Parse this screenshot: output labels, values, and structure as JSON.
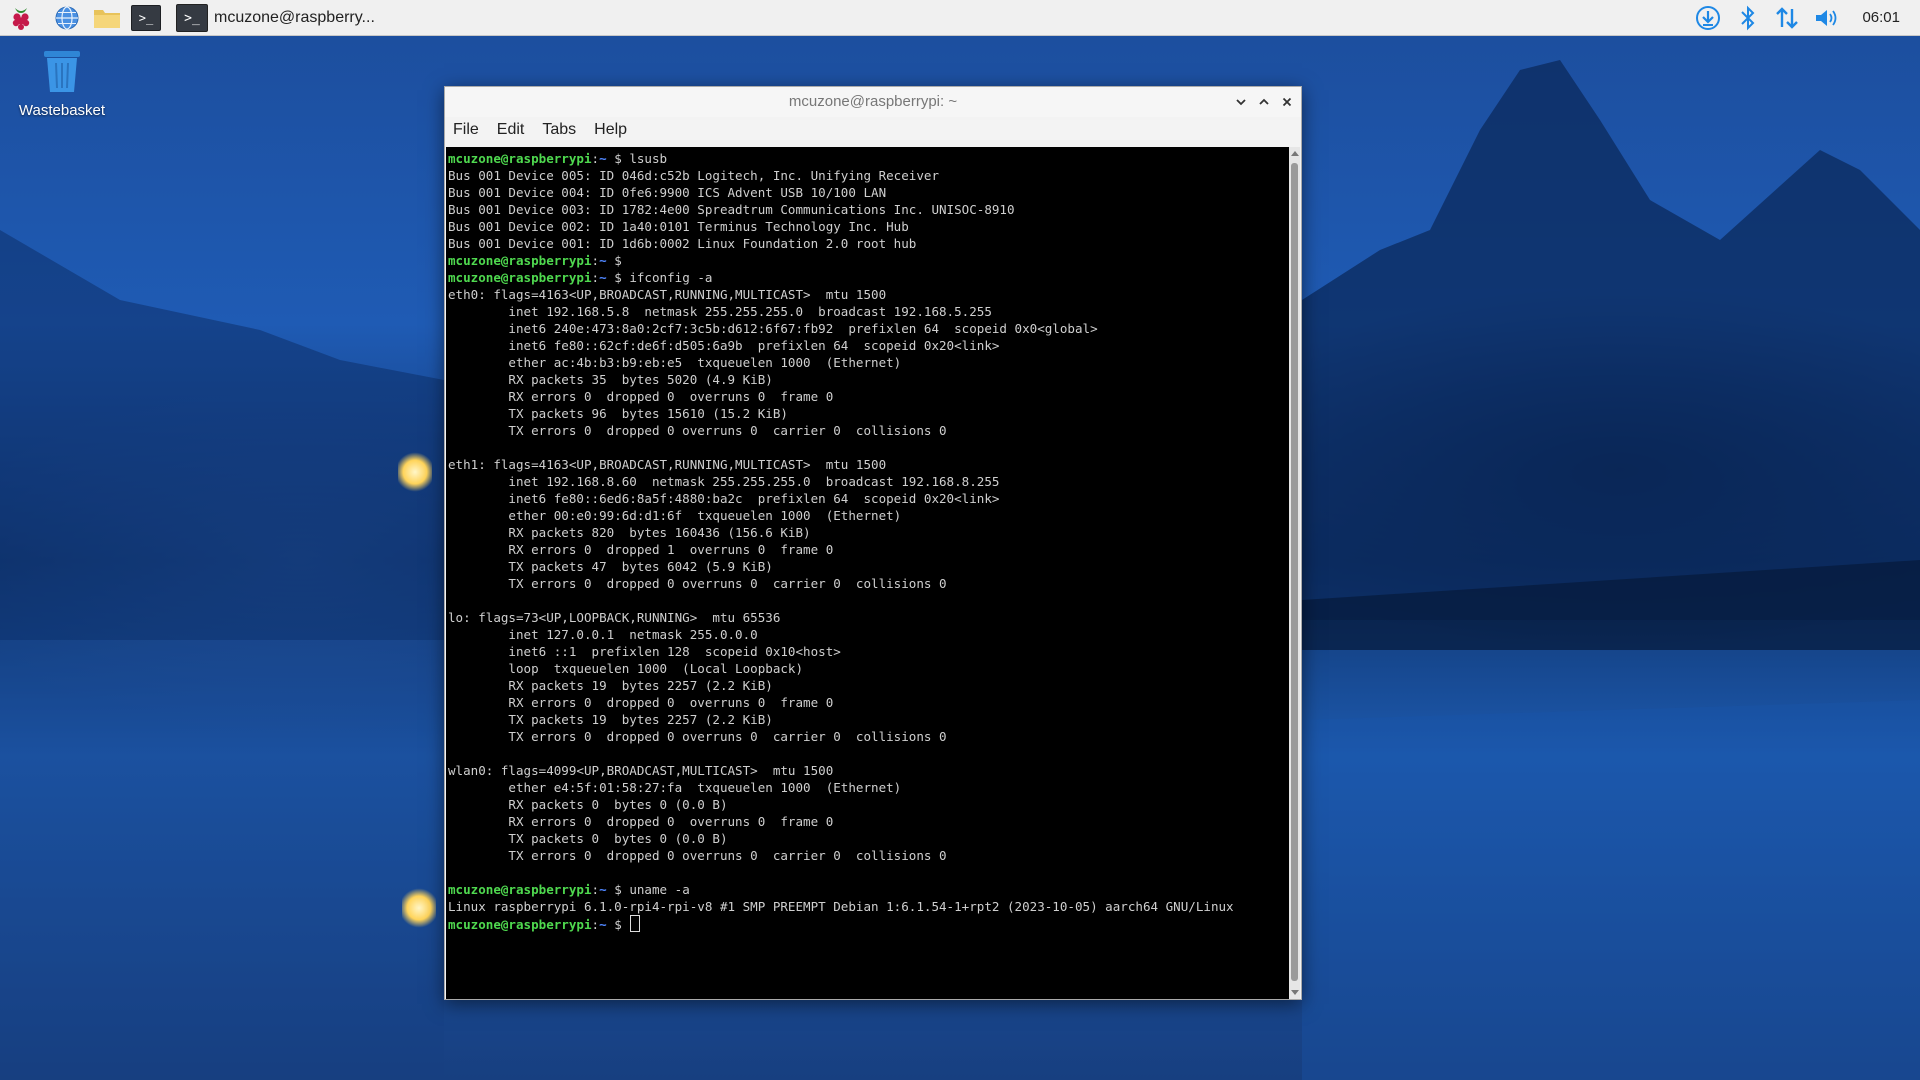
{
  "taskbar": {
    "icons": [
      "raspberry-menu-icon",
      "web-browser-icon",
      "file-manager-icon",
      "terminal-icon"
    ],
    "task_label": "mcuzone@raspberry...",
    "tray_icons": [
      "updater-icon",
      "bluetooth-icon",
      "network-icon",
      "volume-icon"
    ],
    "clock": "06:01",
    "tray_accent_color": "#1e88e5"
  },
  "desktop": {
    "icons": [
      {
        "label": "Wastebasket",
        "icon": "wastebasket-icon"
      }
    ]
  },
  "window": {
    "title": "mcuzone@raspberrypi: ~",
    "controls": [
      "minimize",
      "maximize",
      "close"
    ],
    "menu": [
      "File",
      "Edit",
      "Tabs",
      "Help"
    ]
  },
  "terminal": {
    "colors": {
      "background": "#000000",
      "text": "#cfcfcf",
      "user": "#4fd94f",
      "path": "#4f86ff"
    },
    "prompt_user": "mcuzone@raspberrypi",
    "prompt_path": "~",
    "lines": [
      {
        "type": "prompt",
        "cmd": "lsusb"
      },
      {
        "type": "out",
        "text": "Bus 001 Device 005: ID 046d:c52b Logitech, Inc. Unifying Receiver"
      },
      {
        "type": "out",
        "text": "Bus 001 Device 004: ID 0fe6:9900 ICS Advent USB 10/100 LAN"
      },
      {
        "type": "out",
        "text": "Bus 001 Device 003: ID 1782:4e00 Spreadtrum Communications Inc. UNISOC-8910"
      },
      {
        "type": "out",
        "text": "Bus 001 Device 002: ID 1a40:0101 Terminus Technology Inc. Hub"
      },
      {
        "type": "out",
        "text": "Bus 001 Device 001: ID 1d6b:0002 Linux Foundation 2.0 root hub"
      },
      {
        "type": "prompt",
        "cmd": ""
      },
      {
        "type": "prompt",
        "cmd": "ifconfig -a"
      },
      {
        "type": "out",
        "text": "eth0: flags=4163<UP,BROADCAST,RUNNING,MULTICAST>  mtu 1500"
      },
      {
        "type": "out",
        "text": "        inet 192.168.5.8  netmask 255.255.255.0  broadcast 192.168.5.255"
      },
      {
        "type": "out",
        "text": "        inet6 240e:473:8a0:2cf7:3c5b:d612:6f67:fb92  prefixlen 64  scopeid 0x0<global>"
      },
      {
        "type": "out",
        "text": "        inet6 fe80::62cf:de6f:d505:6a9b  prefixlen 64  scopeid 0x20<link>"
      },
      {
        "type": "out",
        "text": "        ether ac:4b:b3:b9:eb:e5  txqueuelen 1000  (Ethernet)"
      },
      {
        "type": "out",
        "text": "        RX packets 35  bytes 5020 (4.9 KiB)"
      },
      {
        "type": "out",
        "text": "        RX errors 0  dropped 0  overruns 0  frame 0"
      },
      {
        "type": "out",
        "text": "        TX packets 96  bytes 15610 (15.2 KiB)"
      },
      {
        "type": "out",
        "text": "        TX errors 0  dropped 0 overruns 0  carrier 0  collisions 0"
      },
      {
        "type": "out",
        "text": ""
      },
      {
        "type": "out",
        "text": "eth1: flags=4163<UP,BROADCAST,RUNNING,MULTICAST>  mtu 1500"
      },
      {
        "type": "out",
        "text": "        inet 192.168.8.60  netmask 255.255.255.0  broadcast 192.168.8.255"
      },
      {
        "type": "out",
        "text": "        inet6 fe80::6ed6:8a5f:4880:ba2c  prefixlen 64  scopeid 0x20<link>"
      },
      {
        "type": "out",
        "text": "        ether 00:e0:99:6d:d1:6f  txqueuelen 1000  (Ethernet)"
      },
      {
        "type": "out",
        "text": "        RX packets 820  bytes 160436 (156.6 KiB)"
      },
      {
        "type": "out",
        "text": "        RX errors 0  dropped 1  overruns 0  frame 0"
      },
      {
        "type": "out",
        "text": "        TX packets 47  bytes 6042 (5.9 KiB)"
      },
      {
        "type": "out",
        "text": "        TX errors 0  dropped 0 overruns 0  carrier 0  collisions 0"
      },
      {
        "type": "out",
        "text": ""
      },
      {
        "type": "out",
        "text": "lo: flags=73<UP,LOOPBACK,RUNNING>  mtu 65536"
      },
      {
        "type": "out",
        "text": "        inet 127.0.0.1  netmask 255.0.0.0"
      },
      {
        "type": "out",
        "text": "        inet6 ::1  prefixlen 128  scopeid 0x10<host>"
      },
      {
        "type": "out",
        "text": "        loop  txqueuelen 1000  (Local Loopback)"
      },
      {
        "type": "out",
        "text": "        RX packets 19  bytes 2257 (2.2 KiB)"
      },
      {
        "type": "out",
        "text": "        RX errors 0  dropped 0  overruns 0  frame 0"
      },
      {
        "type": "out",
        "text": "        TX packets 19  bytes 2257 (2.2 KiB)"
      },
      {
        "type": "out",
        "text": "        TX errors 0  dropped 0 overruns 0  carrier 0  collisions 0"
      },
      {
        "type": "out",
        "text": ""
      },
      {
        "type": "out",
        "text": "wlan0: flags=4099<UP,BROADCAST,MULTICAST>  mtu 1500"
      },
      {
        "type": "out",
        "text": "        ether e4:5f:01:58:27:fa  txqueuelen 1000  (Ethernet)"
      },
      {
        "type": "out",
        "text": "        RX packets 0  bytes 0 (0.0 B)"
      },
      {
        "type": "out",
        "text": "        RX errors 0  dropped 0  overruns 0  frame 0"
      },
      {
        "type": "out",
        "text": "        TX packets 0  bytes 0 (0.0 B)"
      },
      {
        "type": "out",
        "text": "        TX errors 0  dropped 0 overruns 0  carrier 0  collisions 0"
      },
      {
        "type": "out",
        "text": ""
      },
      {
        "type": "prompt",
        "cmd": "uname -a"
      },
      {
        "type": "out",
        "text": "Linux raspberrypi 6.1.0-rpi4-rpi-v8 #1 SMP PREEMPT Debian 1:6.1.54-1+rpt2 (2023-10-05) aarch64 GNU/Linux"
      },
      {
        "type": "prompt",
        "cmd": "",
        "cursor": true
      }
    ]
  }
}
